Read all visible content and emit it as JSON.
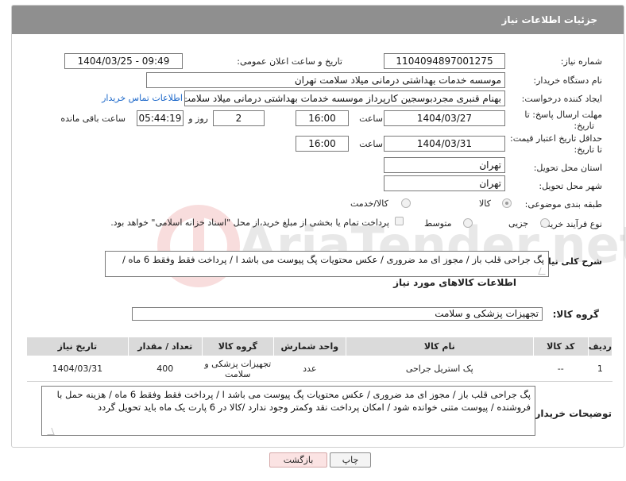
{
  "header": {
    "title": "جزئیات اطلاعات نیاز"
  },
  "form": {
    "need_number": {
      "label": "شماره نیاز:",
      "value": "1104094897001275"
    },
    "announce_datetime": {
      "label": "تاریخ و ساعت اعلان عمومی:",
      "value": "1404/03/25 - 09:49"
    },
    "buyer_org": {
      "label": "نام دستگاه خریدار:",
      "value": "موسسه خدمات بهداشتی درمانی میلاد سلامت تهران"
    },
    "requester": {
      "label": "ایجاد کننده درخواست:",
      "value": "بهنام قنبری مجردبوسجین کارپرداز موسسه خدمات بهداشتی درمانی میلاد سلامت",
      "contact_link": "اطلاعات تماس خریدار"
    },
    "reply_deadline": {
      "label_line1": "مهلت ارسال پاسخ: تا",
      "label_line2": "تاریخ:",
      "date": "1404/03/27",
      "time_label": "ساعت",
      "time": "16:00",
      "days": "2",
      "days_label": "روز و",
      "remaining": "05:44:19",
      "remaining_label": "ساعت باقی مانده"
    },
    "price_validity": {
      "label_line1": "حداقل تاریخ اعتبار قیمت:",
      "label_line2": "تا تاریخ:",
      "date": "1404/03/31",
      "time_label": "ساعت",
      "time": "16:00"
    },
    "delivery_province": {
      "label": "استان محل تحویل:",
      "value": "تهران"
    },
    "delivery_city": {
      "label": "شهر محل تحویل:",
      "value": "تهران"
    },
    "category": {
      "label": "طبقه بندی موضوعی:",
      "options": [
        "کالا",
        "کالا/خدمت"
      ],
      "selected": "کالا"
    },
    "process_type": {
      "label": "نوع فرآیند خرید :",
      "options": [
        "جزیی",
        "متوسط"
      ],
      "treasury_note": "پرداخت تمام یا بخشی از مبلغ خرید،از محل \"اسناد خزانه اسلامی\" خواهد بود."
    },
    "description": {
      "label": "شرح کلی نیاز:",
      "value": "پگ جراحی قلب  باز / مجوز ای مد ضروری / عکس محتویات پگ پیوست می باشد ا  / پرداخت فقط وفقط 6  ماه  /"
    }
  },
  "goods": {
    "section_title": "اطلاعات کالاهای مورد نیاز",
    "group_label": "گروه کالا:",
    "group_value": "تجهیزات پزشکی و سلامت",
    "columns": [
      "ردیف",
      "کد کالا",
      "نام کالا",
      "واحد شمارش",
      "گروه کالا",
      "تعداد / مقدار",
      "تاریخ نیاز"
    ],
    "rows": [
      {
        "row": "1",
        "code": "--",
        "name": "پک استریل جراحی",
        "unit": "عدد",
        "group": "تجهیزات پزشکی و سلامت",
        "qty": "400",
        "date": "1404/03/31"
      }
    ]
  },
  "buyer_notes": {
    "label": "توضیحات خریدار:",
    "value": "پگ جراحی قلب  باز / مجوز ای مد ضروری / عکس محتویات پگ پیوست می باشد ا  / پرداخت فقط وفقط 6  ماه / هزینه حمل با فروشنده / پیوست  متنی خوانده شود / امکان پرداخت نقد وکمتر وجود ندارد /کالا در 6 پارت یک ماه باید تحویل گردد"
  },
  "buttons": {
    "print": "چاپ",
    "back": "بازگشت"
  },
  "colors": {
    "header_bg": "#8f8f8f",
    "link": "#1a66c9",
    "back_button_bg": "#fbe3e3",
    "table_header_bg": "#dadada"
  }
}
